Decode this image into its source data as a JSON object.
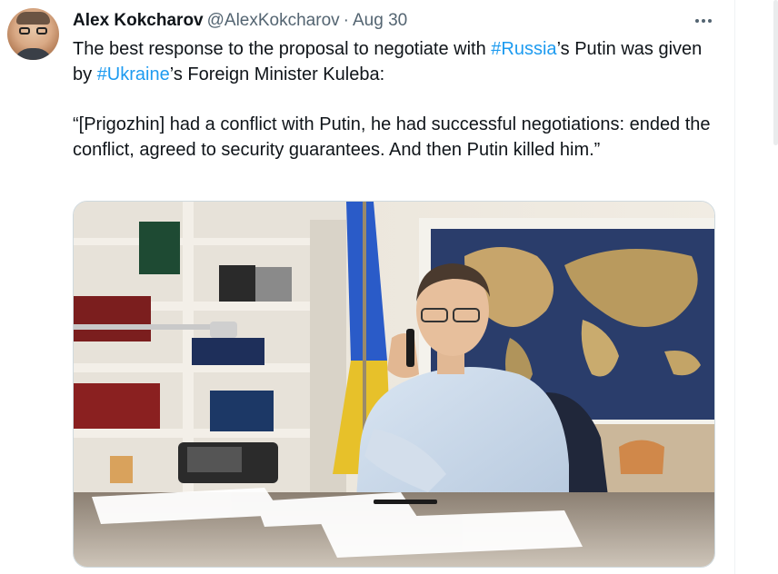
{
  "tweet": {
    "author_name": "Alex Kokcharov",
    "author_handle": "@AlexKokcharov",
    "separator": "·",
    "date": "Aug 30",
    "text": {
      "l1_a": "The best response to the proposal to negotiate with ",
      "hashtag_russia": "#Russia",
      "l1_b": "’s Putin was given by ",
      "hashtag_ukraine": "#Ukraine",
      "l1_c": "’s Foreign Minister Kuleba:",
      "quote": "“[Prigozhin] had a conflict with Putin, he had successful negotiations: ended the conflict, agreed to security guarantees. And then Putin killed him.”"
    },
    "media": {
      "description_icon": "photo"
    }
  },
  "icons": {
    "more": "more-horizontal-icon"
  },
  "colors": {
    "hashtag": "#1d9bf0",
    "secondary_text": "#536471",
    "border": "#cfd9de"
  }
}
